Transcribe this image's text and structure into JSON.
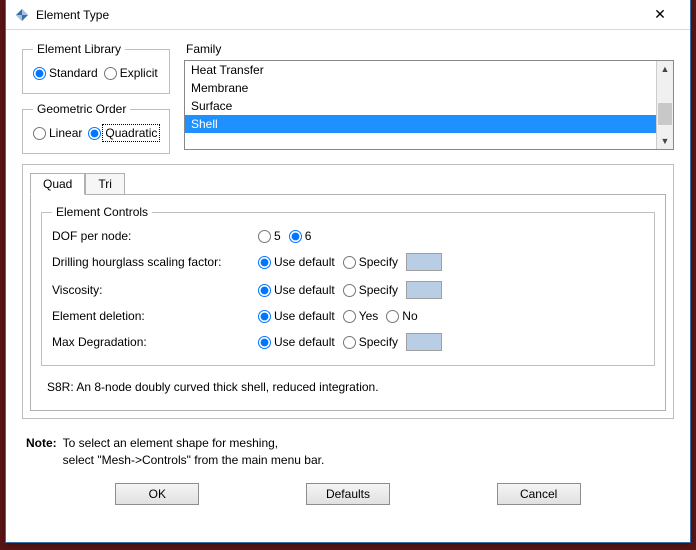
{
  "window": {
    "title": "Element Type",
    "close": "✕"
  },
  "lib": {
    "legend": "Element Library",
    "standard": "Standard",
    "explicit": "Explicit",
    "selected": "standard"
  },
  "geo": {
    "legend": "Geometric Order",
    "linear": "Linear",
    "quadratic": "Quadratic",
    "selected": "quadratic"
  },
  "family": {
    "label": "Family",
    "items": [
      "Heat Transfer",
      "Membrane",
      "Surface",
      "Shell"
    ],
    "selected": "Shell"
  },
  "tabs": {
    "quad": "Quad",
    "tri": "Tri",
    "active": "quad"
  },
  "controls": {
    "legend": "Element Controls",
    "dof_label": "DOF per node:",
    "dof_opt_5": "5",
    "dof_opt_6": "6",
    "dof_selected": "6",
    "drill_label": "Drilling hourglass scaling factor:",
    "visc_label": "Viscosity:",
    "eldel_label": "Element deletion:",
    "maxdeg_label": "Max Degradation:",
    "use_default": "Use default",
    "specify": "Specify",
    "yes": "Yes",
    "no": "No",
    "drill_sel": "default",
    "visc_sel": "default",
    "eldel_sel": "default",
    "maxdeg_sel": "default"
  },
  "description": "S8R:  An 8-node doubly curved thick shell, reduced integration.",
  "note": {
    "label": "Note:",
    "line1": "To select an element shape for meshing,",
    "line2": "select \"Mesh->Controls\" from the main menu bar."
  },
  "buttons": {
    "ok": "OK",
    "defaults": "Defaults",
    "cancel": "Cancel"
  }
}
